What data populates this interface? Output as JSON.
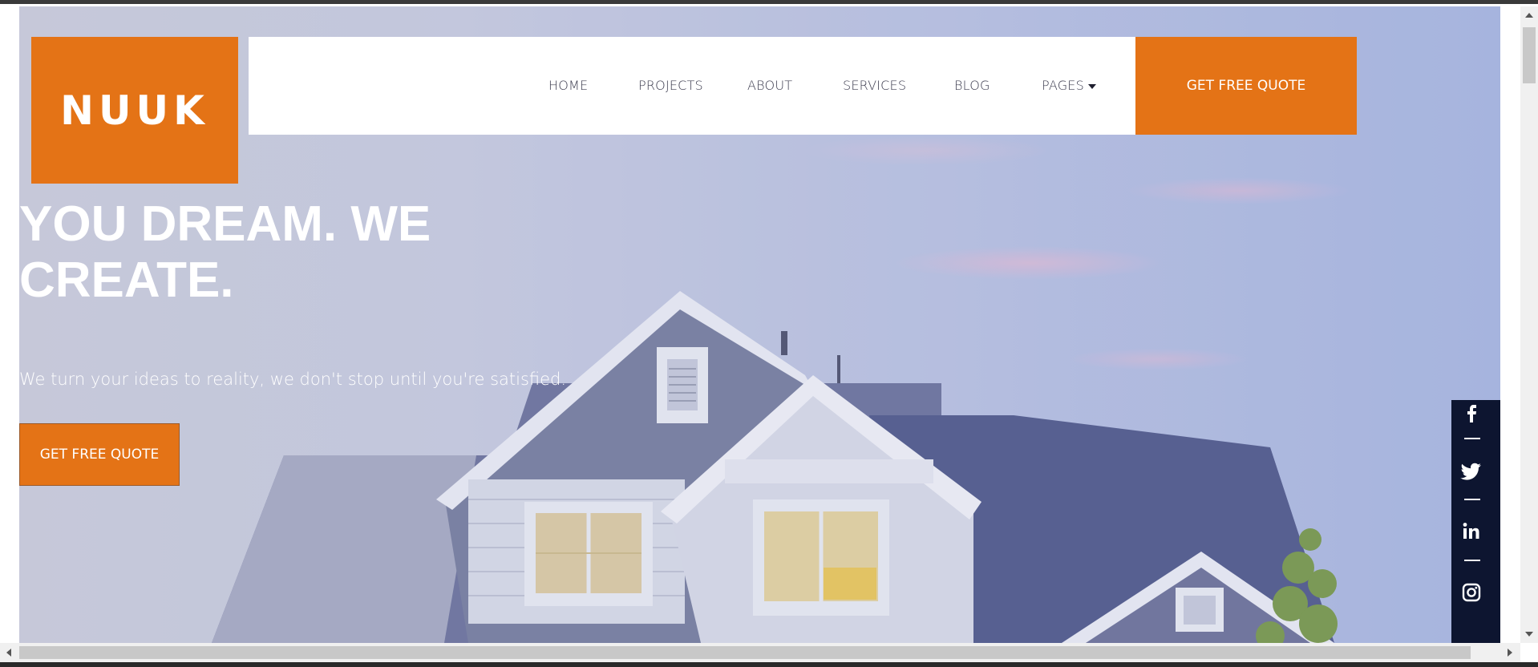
{
  "brand": {
    "logo": "NUUK",
    "accent_color": "#e47316",
    "dark_color": "#0d1530"
  },
  "nav": {
    "items": [
      {
        "label": "HOME"
      },
      {
        "label": "PROJECTS"
      },
      {
        "label": "ABOUT"
      },
      {
        "label": "SERVICES"
      },
      {
        "label": "BLOG"
      },
      {
        "label": "PAGES"
      }
    ],
    "cta": "GET FREE QUOTE"
  },
  "hero": {
    "title": "YOU DREAM. WE CREATE.",
    "subtitle": "We turn your ideas to reality, we don't stop until you're satisfied.",
    "button": "GET FREE QUOTE"
  },
  "social": {
    "items": [
      {
        "icon": "facebook-icon"
      },
      {
        "icon": "twitter-icon"
      },
      {
        "icon": "linkedin-icon"
      },
      {
        "icon": "instagram-icon"
      }
    ]
  }
}
